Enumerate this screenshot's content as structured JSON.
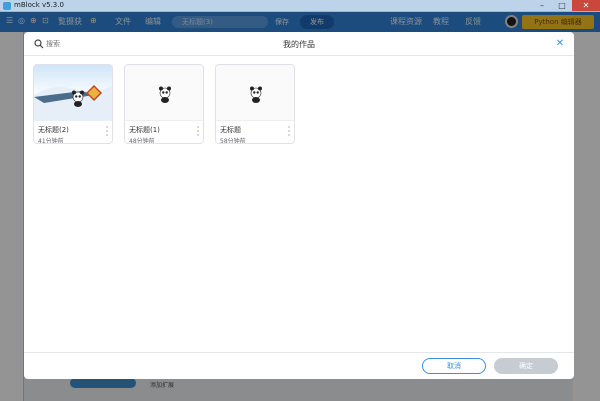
{
  "window": {
    "title": "mBlock v5.3.0"
  },
  "menubar": {
    "items": [
      "☰",
      "◎",
      "⊕",
      "⊡",
      "覧摄获",
      "⊕",
      "文件",
      "编辑"
    ],
    "project_name": "无标题(3)",
    "save_label": "保存",
    "publish_label": "发布",
    "links": [
      "课程资源",
      "教程",
      "反馈"
    ],
    "python_label": "Python 编辑器"
  },
  "background": {
    "extension_label": "添加扩展"
  },
  "modal": {
    "title": "我的作品",
    "search_placeholder": "搜索",
    "projects": [
      {
        "name": "无标题(2)",
        "time": "41分钟前"
      },
      {
        "name": "无标题(1)",
        "time": "48分钟前"
      },
      {
        "name": "无标题",
        "time": "58分钟前"
      }
    ],
    "cancel_label": "取消",
    "confirm_label": "确定"
  },
  "colors": {
    "accent": "#3a8ee6",
    "menubar": "#2f84d8",
    "python_button": "#ffc627"
  },
  "icons": [
    "search-icon",
    "close-icon",
    "more-icon",
    "panda-icon"
  ]
}
